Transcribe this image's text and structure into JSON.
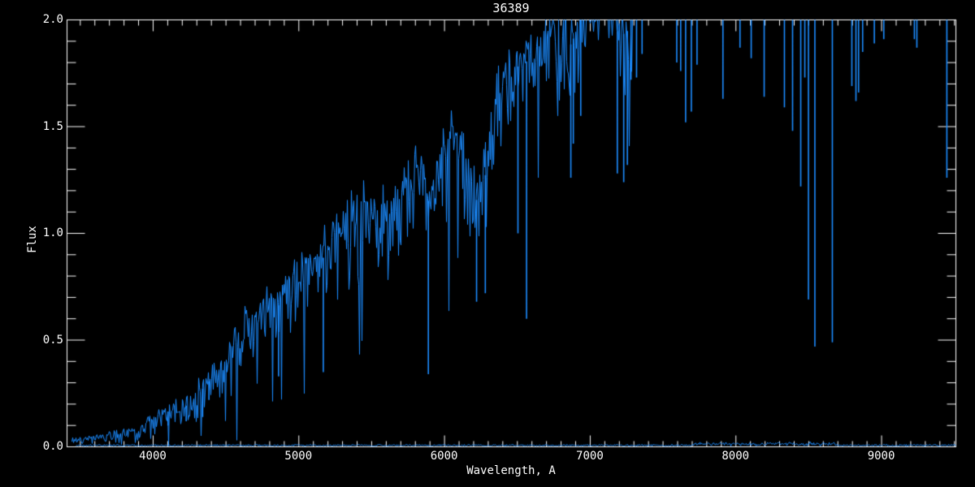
{
  "window": {
    "background_color": "#000000"
  },
  "chart_data": {
    "type": "line",
    "title": "36389",
    "xlabel": "Wavelength, A",
    "ylabel": "Flux",
    "xlim": [
      3409,
      9510
    ],
    "ylim": [
      0.0,
      2.0
    ],
    "grid": false,
    "legend": null,
    "axis_color": "#ffffff",
    "text_color": "#ffffff",
    "background_color": "#000000",
    "x_major_ticks": [
      4000,
      5000,
      6000,
      7000,
      8000,
      9000
    ],
    "x_tick_labels": [
      "4000",
      "5000",
      "6000",
      "7000",
      "8000",
      "9000"
    ],
    "x_minor_step": 100,
    "y_major_ticks": [
      0.0,
      0.5,
      1.0,
      1.5,
      2.0
    ],
    "y_tick_labels": [
      "0.0",
      "0.5",
      "1.0",
      "1.5",
      "2.0"
    ],
    "y_minor_step": 0.1,
    "random_seed": 20477,
    "series": [
      {
        "name": "object-spectrum",
        "color": "#1c8cff",
        "x_start": 3445,
        "x_end": 9510,
        "clip_top_flux": 2.0,
        "continuum": [
          [
            3430,
            0.03
          ],
          [
            3550,
            0.04
          ],
          [
            3700,
            0.055
          ],
          [
            3850,
            0.07
          ],
          [
            3950,
            0.1
          ],
          [
            4050,
            0.16
          ],
          [
            4150,
            0.17
          ],
          [
            4250,
            0.2
          ],
          [
            4350,
            0.28
          ],
          [
            4450,
            0.36
          ],
          [
            4550,
            0.48
          ],
          [
            4650,
            0.58
          ],
          [
            4750,
            0.62
          ],
          [
            4850,
            0.65
          ],
          [
            4950,
            0.76
          ],
          [
            5050,
            0.84
          ],
          [
            5150,
            0.87
          ],
          [
            5250,
            0.96
          ],
          [
            5350,
            1.02
          ],
          [
            5450,
            1.07
          ],
          [
            5550,
            1.1
          ],
          [
            5650,
            1.08
          ],
          [
            5750,
            1.2
          ],
          [
            5820,
            1.3
          ],
          [
            5890,
            1.15
          ],
          [
            5960,
            1.32
          ],
          [
            6050,
            1.48
          ],
          [
            6120,
            1.38
          ],
          [
            6180,
            1.18
          ],
          [
            6250,
            1.14
          ],
          [
            6320,
            1.45
          ],
          [
            6400,
            1.68
          ],
          [
            6500,
            1.78
          ],
          [
            6600,
            1.82
          ],
          [
            6700,
            1.92
          ],
          [
            6800,
            2.0
          ],
          [
            6870,
            1.88
          ],
          [
            6930,
            2.02
          ],
          [
            7000,
            2.15
          ],
          [
            7080,
            2.22
          ],
          [
            7150,
            2.02
          ],
          [
            7200,
            1.92
          ],
          [
            7260,
            1.95
          ],
          [
            7320,
            2.1
          ],
          [
            7400,
            2.35
          ],
          [
            7500,
            2.45
          ],
          [
            9510,
            2.5
          ]
        ],
        "noise_halfwidth": [
          [
            3430,
            0.012
          ],
          [
            3600,
            0.02
          ],
          [
            3800,
            0.03
          ],
          [
            3950,
            0.045
          ],
          [
            4100,
            0.06
          ],
          [
            4250,
            0.09
          ],
          [
            4450,
            0.11
          ],
          [
            4650,
            0.12
          ],
          [
            4850,
            0.14
          ],
          [
            5050,
            0.17
          ],
          [
            5250,
            0.18
          ],
          [
            5450,
            0.19
          ],
          [
            5650,
            0.18
          ],
          [
            5850,
            0.17
          ],
          [
            6050,
            0.2
          ],
          [
            6250,
            0.22
          ],
          [
            6450,
            0.2
          ],
          [
            6650,
            0.18
          ],
          [
            6850,
            0.22
          ],
          [
            7000,
            0.26
          ],
          [
            7150,
            0.3
          ],
          [
            7300,
            0.28
          ],
          [
            7400,
            0.15
          ],
          [
            7600,
            0.1
          ],
          [
            9510,
            0.1
          ]
        ],
        "absorption_lines": [
          [
            4102,
            0.1
          ],
          [
            4227,
            0.12
          ],
          [
            4340,
            0.14
          ],
          [
            4383,
            0.22
          ],
          [
            4861,
            0.33
          ],
          [
            5168,
            0.35
          ],
          [
            5889,
            0.34
          ],
          [
            6220,
            0.68
          ],
          [
            6280,
            0.72
          ],
          [
            6504,
            1.0
          ],
          [
            6563,
            0.6
          ],
          [
            6867,
            1.26
          ],
          [
            6884,
            1.42
          ],
          [
            6935,
            1.55
          ],
          [
            7186,
            1.28
          ],
          [
            7230,
            1.24
          ],
          [
            7255,
            1.32
          ],
          [
            7280,
            1.72
          ],
          [
            7318,
            1.73
          ],
          [
            7356,
            1.84
          ],
          [
            7594,
            1.8
          ],
          [
            7621,
            1.76
          ],
          [
            7655,
            1.52
          ],
          [
            7694,
            1.57
          ],
          [
            7733,
            1.79
          ],
          [
            7911,
            1.63
          ],
          [
            8028,
            1.87
          ],
          [
            8105,
            1.82
          ],
          [
            8194,
            1.64
          ],
          [
            8333,
            1.59
          ],
          [
            8389,
            1.48
          ],
          [
            8445,
            1.22
          ],
          [
            8473,
            1.73
          ],
          [
            8498,
            0.69
          ],
          [
            8542,
            0.47
          ],
          [
            8662,
            0.49
          ],
          [
            8796,
            1.69
          ],
          [
            8824,
            1.62
          ],
          [
            8842,
            1.66
          ],
          [
            8870,
            1.85
          ],
          [
            8950,
            1.89
          ],
          [
            9015,
            1.91
          ],
          [
            9225,
            1.91
          ],
          [
            9242,
            1.87
          ],
          [
            9448,
            1.26
          ]
        ]
      },
      {
        "name": "zero-baseline-spectrum",
        "color": "#1c8cff",
        "x_start": 3470,
        "x_end": 9510,
        "level": 0.007,
        "jitter": 0.004,
        "bump_range": [
          7700,
          8700
        ],
        "bump_extra": 0.012
      }
    ]
  }
}
